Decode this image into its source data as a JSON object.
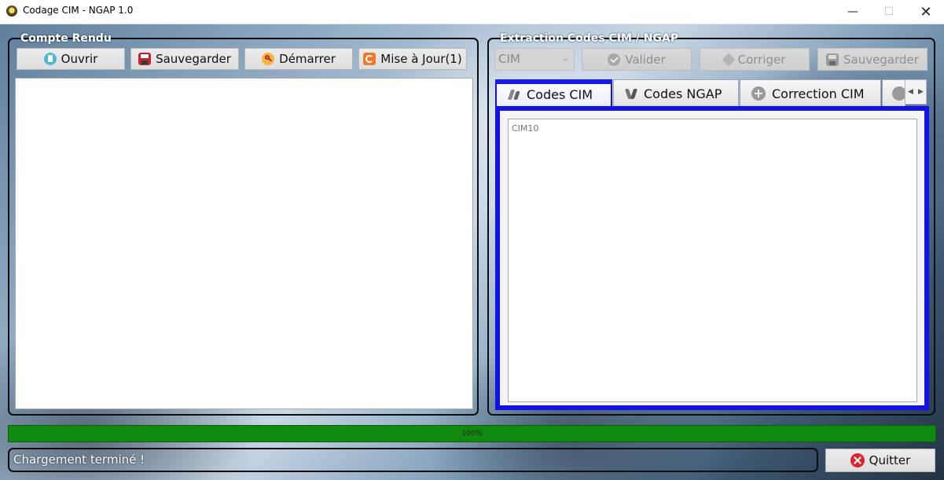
{
  "window": {
    "title": "Codage CIM - NGAP 1.0",
    "minimize_glyph": "—",
    "maximize_glyph": "☐",
    "close_glyph": "✕"
  },
  "left_panel": {
    "label": "Compte Rendu",
    "buttons": [
      {
        "label": "Ouvrir",
        "icon": "open-file-icon"
      },
      {
        "label": "Sauvegarder",
        "icon": "floppy-disk-icon"
      },
      {
        "label": "Démarrer",
        "icon": "key-icon"
      },
      {
        "label": "Mise à Jour(1)",
        "icon": "refresh-icon"
      }
    ],
    "text_content": ""
  },
  "right_panel": {
    "label": "Extraction Codes CIM / NGAP",
    "combo": {
      "value": "CIM",
      "arrow": "⌄"
    },
    "buttons": [
      {
        "label": "Valider",
        "icon": "check-icon",
        "enabled": false
      },
      {
        "label": "Corriger",
        "icon": "diamond-icon",
        "enabled": false
      },
      {
        "label": "Sauvegarder",
        "icon": "floppy-disk-icon",
        "enabled": false
      }
    ],
    "tabs": [
      {
        "label": "Codes CIM",
        "icon": "feather-icon",
        "active": true
      },
      {
        "label": "Codes NGAP",
        "icon": "feather-icon",
        "active": false
      },
      {
        "label": "Correction CIM",
        "icon": "plus-circle-icon",
        "active": false
      }
    ],
    "tab_scroll": {
      "left": "◀",
      "right": "▶"
    },
    "cim_box_label": "CIM10"
  },
  "progress": {
    "value": 100,
    "text": "100%"
  },
  "status_text": "Chargement terminé !",
  "quit_button": {
    "label": "Quitter",
    "icon": "close-circle-icon"
  },
  "colors": {
    "progress_fill": "#0f8a0f",
    "tab_accent": "#1212e6",
    "quit_icon": "#d9262c"
  }
}
